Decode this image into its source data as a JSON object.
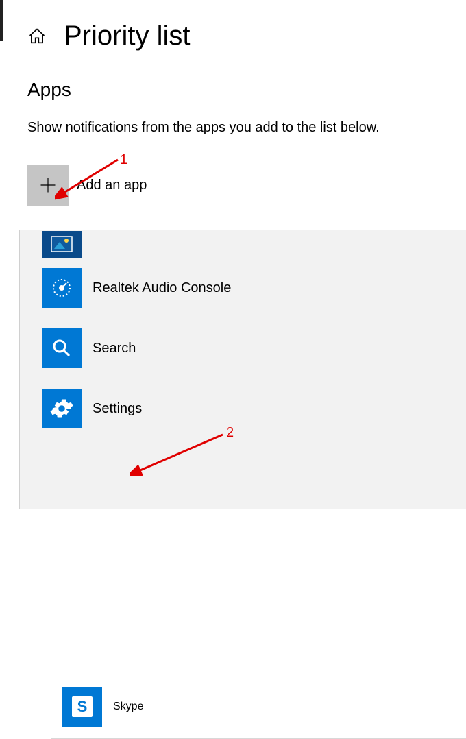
{
  "header": {
    "title": "Priority list"
  },
  "section": {
    "title": "Apps",
    "description": "Show notifications from the apps you add to the list below.",
    "add_label": "Add an app"
  },
  "apps": [
    {
      "name": "",
      "icon": "photos"
    },
    {
      "name": "Realtek Audio Console",
      "icon": "realtek"
    },
    {
      "name": "Search",
      "icon": "search"
    },
    {
      "name": "Settings",
      "icon": "settings"
    },
    {
      "name": "Skype",
      "icon": "skype"
    }
  ],
  "annotations": {
    "label1": "1",
    "label2": "2"
  }
}
